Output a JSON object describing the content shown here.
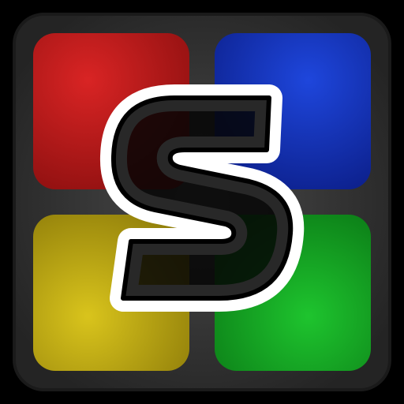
{
  "icon": {
    "name": "simon-color-game-app-icon",
    "letter": "S",
    "colors": {
      "background": "#000000",
      "frame": "#3a3a3a",
      "frame_edge": "#1a1a1a",
      "tile_red": "#c81e1e",
      "tile_blue": "#1236c4",
      "tile_yellow": "#ccb616",
      "tile_green": "#14a824",
      "letter_fill": "#000000",
      "letter_outline": "#ffffff"
    },
    "tiles": [
      {
        "name": "red-tile",
        "color": "red"
      },
      {
        "name": "blue-tile",
        "color": "blue"
      },
      {
        "name": "yellow-tile",
        "color": "yellow"
      },
      {
        "name": "green-tile",
        "color": "green"
      }
    ]
  }
}
